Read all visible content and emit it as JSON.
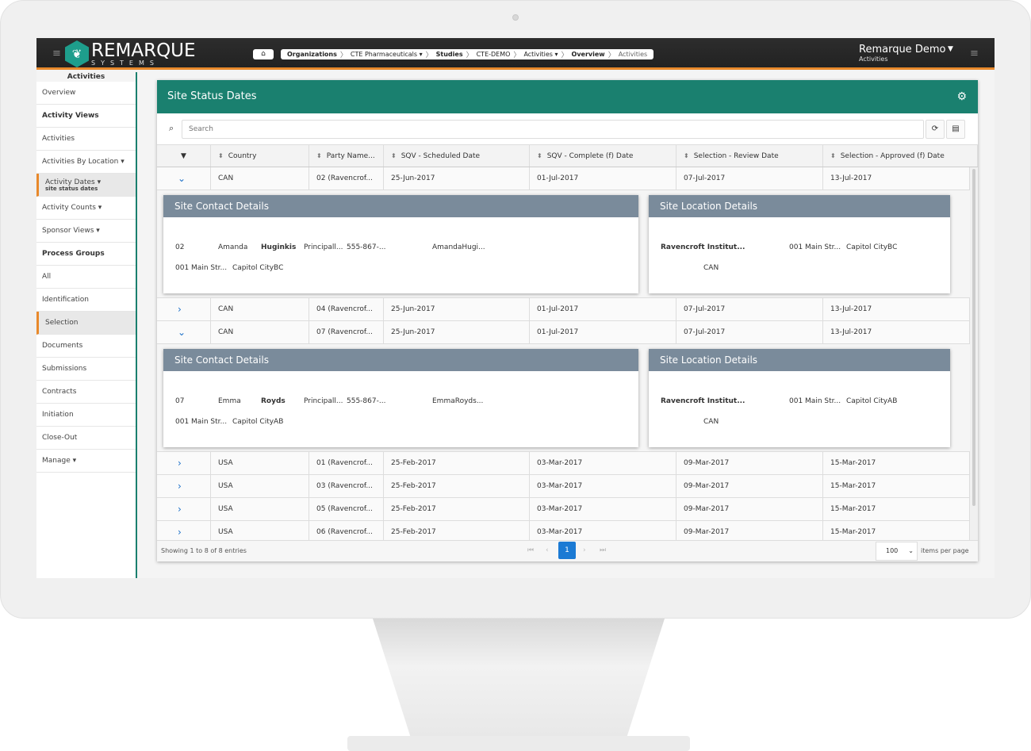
{
  "header": {
    "brand": "REMARQUE",
    "brand_sub": "SYSTEMS",
    "breadcrumb": [
      {
        "label": "Organizations",
        "bold": true
      },
      {
        "label": "CTE Pharmaceuticals ▾",
        "bold": false
      },
      {
        "label": "Studies",
        "bold": true
      },
      {
        "label": "CTE-DEMO",
        "bold": false
      },
      {
        "label": "Activities ▾",
        "bold": false
      },
      {
        "label": "Overview",
        "bold": true
      },
      {
        "label": "Activities",
        "bold": false,
        "current": true
      }
    ],
    "user_name": "Remarque Demo",
    "user_context": "Activities"
  },
  "sidebar": {
    "title": "Activities",
    "items": [
      {
        "label": "Overview"
      },
      {
        "label": "Activity Views",
        "bold": true
      },
      {
        "label": "Activities"
      },
      {
        "label": "Activities By Location ▾"
      },
      {
        "label": "Activity Dates ▾",
        "sub": "site status dates",
        "active": true
      },
      {
        "label": "Activity Counts ▾"
      },
      {
        "label": "Sponsor Views ▾"
      },
      {
        "label": "Process Groups",
        "bold": true
      },
      {
        "label": "All"
      },
      {
        "label": "Identification"
      },
      {
        "label": "Selection",
        "active": true
      },
      {
        "label": "Documents"
      },
      {
        "label": "Submissions"
      },
      {
        "label": "Contracts"
      },
      {
        "label": "Initiation"
      },
      {
        "label": "Close-Out"
      },
      {
        "label": "Manage ▾"
      }
    ]
  },
  "panel": {
    "title": "Site Status Dates",
    "search_placeholder": "Search",
    "columns": [
      "Country",
      "Party Name...",
      "SQV - Scheduled Date",
      "SQV - Complete (f) Date",
      "Selection - Review Date",
      "Selection - Approved (f) Date"
    ],
    "rows": [
      {
        "expanded": true,
        "cells": [
          "CAN",
          "02 (Ravencrof...",
          "25-Jun-2017",
          "01-Jul-2017",
          "07-Jul-2017",
          "13-Jul-2017"
        ],
        "contact": {
          "title": "Site Contact Details",
          "id": "02",
          "first": "Amanda",
          "last": "Huginkis",
          "role": "Principall...",
          "phone": "555-867-...",
          "email": "AmandaHugi...",
          "street": "001 Main Str...",
          "city": "Capitol CityBC"
        },
        "location": {
          "title": "Site Location Details",
          "name": "Ravencroft Institut...",
          "street": "001 Main Str...",
          "city": "Capitol CityBC",
          "country": "CAN"
        }
      },
      {
        "expanded": false,
        "cells": [
          "CAN",
          "04 (Ravencrof...",
          "25-Jun-2017",
          "01-Jul-2017",
          "07-Jul-2017",
          "13-Jul-2017"
        ]
      },
      {
        "expanded": true,
        "cells": [
          "CAN",
          "07 (Ravencrof...",
          "25-Jun-2017",
          "01-Jul-2017",
          "07-Jul-2017",
          "13-Jul-2017"
        ],
        "contact": {
          "title": "Site Contact Details",
          "id": "07",
          "first": "Emma",
          "last": "Royds",
          "role": "Principall...",
          "phone": "555-867-...",
          "email": "EmmaRoyds...",
          "street": "001 Main Str...",
          "city": "Capitol CityAB"
        },
        "location": {
          "title": "Site Location Details",
          "name": "Ravencroft Institut...",
          "street": "001 Main Str...",
          "city": "Capitol CityAB",
          "country": "CAN"
        }
      },
      {
        "expanded": false,
        "cells": [
          "USA",
          "01 (Ravencrof...",
          "25-Feb-2017",
          "03-Mar-2017",
          "09-Mar-2017",
          "15-Mar-2017"
        ]
      },
      {
        "expanded": false,
        "cells": [
          "USA",
          "03 (Ravencrof...",
          "25-Feb-2017",
          "03-Mar-2017",
          "09-Mar-2017",
          "15-Mar-2017"
        ]
      },
      {
        "expanded": false,
        "cells": [
          "USA",
          "05 (Ravencrof...",
          "25-Feb-2017",
          "03-Mar-2017",
          "09-Mar-2017",
          "15-Mar-2017"
        ]
      },
      {
        "expanded": false,
        "cells": [
          "USA",
          "06 (Ravencrof...",
          "25-Feb-2017",
          "03-Mar-2017",
          "09-Mar-2017",
          "15-Mar-2017"
        ]
      }
    ],
    "footer": {
      "info": "Showing 1 to 8 of 8 entries",
      "current_page": "1",
      "page_size": "100",
      "page_size_label": "items per page"
    }
  },
  "colors": {
    "header_teal": "#1a806f",
    "accent_orange": "#e8892b",
    "card_header": "#7a8b9b",
    "page_active": "#1b7ad4"
  }
}
